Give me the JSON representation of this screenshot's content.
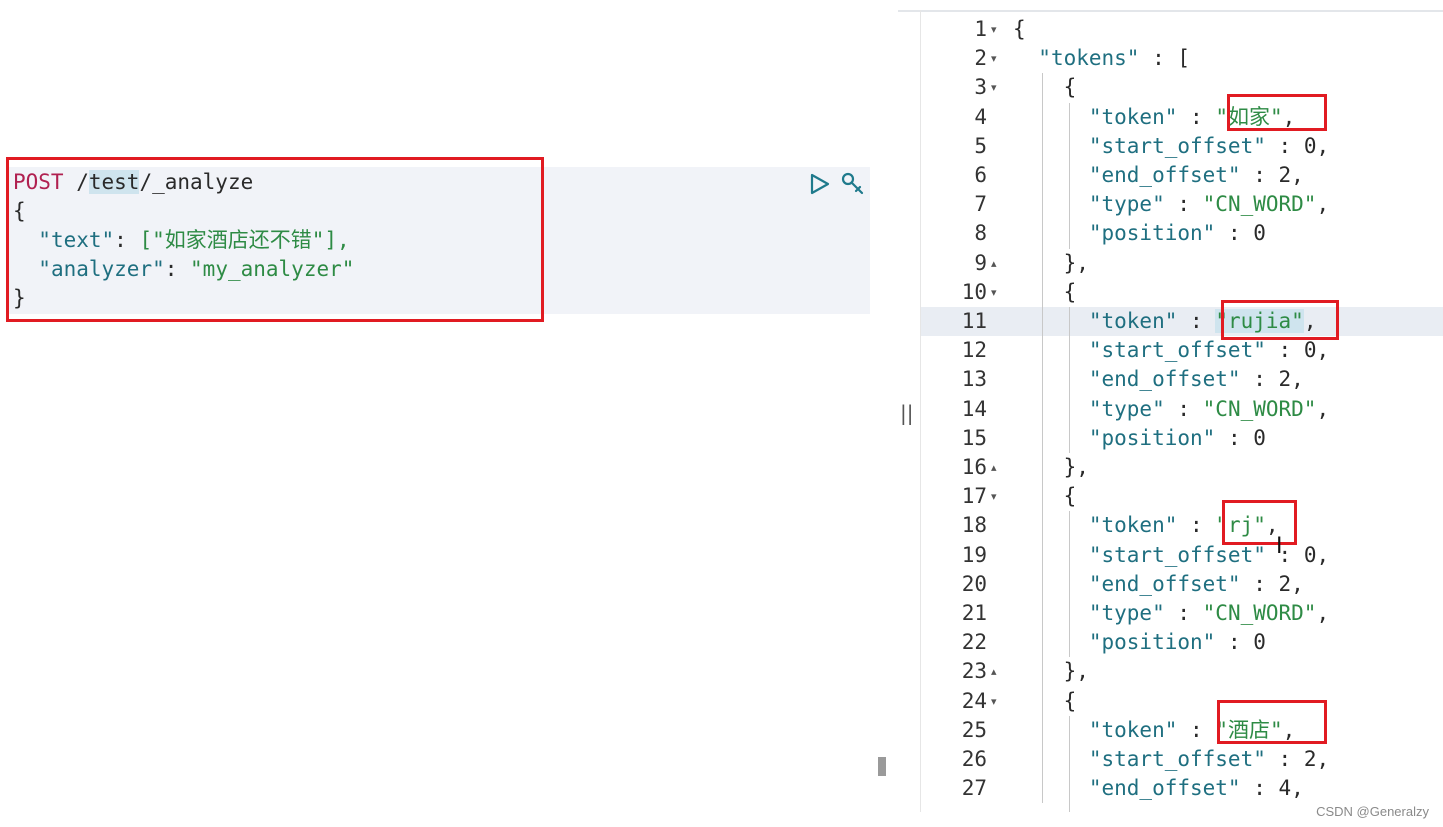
{
  "request": {
    "method": "POST",
    "path_prefix": " /",
    "index": "test",
    "path_suffix": "/_analyze",
    "open_brace": "{",
    "text_key": "\"text\"",
    "text_value": "[\"如家酒店还不错\"],",
    "analyzer_key": "\"analyzer\"",
    "analyzer_value": "\"my_analyzer\"",
    "close_brace": "}",
    "run_icon": "play-icon",
    "settings_icon": "wrench-icon"
  },
  "resize_handle": "||",
  "response": {
    "lines": [
      {
        "n": "1",
        "fold": "▾",
        "text": "{"
      },
      {
        "n": "2",
        "fold": "▾",
        "key": "\"tokens\"",
        "rest": " : ["
      },
      {
        "n": "3",
        "fold": "▾",
        "text": "{"
      },
      {
        "n": "4",
        "key": "\"token\"",
        "sep": " : ",
        "str": "\"如家\"",
        "rest": ","
      },
      {
        "n": "5",
        "key": "\"start_offset\"",
        "sep": " : ",
        "rest": "0,"
      },
      {
        "n": "6",
        "key": "\"end_offset\"",
        "sep": " : ",
        "rest": "2,"
      },
      {
        "n": "7",
        "key": "\"type\"",
        "sep": " : ",
        "str": "\"CN_WORD\"",
        "rest": ","
      },
      {
        "n": "8",
        "key": "\"position\"",
        "sep": " : ",
        "rest": "0"
      },
      {
        "n": "9",
        "fold": "▴",
        "text": "},"
      },
      {
        "n": "10",
        "fold": "▾",
        "text": "{"
      },
      {
        "n": "11",
        "key": "\"token\"",
        "sep": " : ",
        "str": "\"rujia\"",
        "rest": ","
      },
      {
        "n": "12",
        "key": "\"start_offset\"",
        "sep": " : ",
        "rest": "0,"
      },
      {
        "n": "13",
        "key": "\"end_offset\"",
        "sep": " : ",
        "rest": "2,"
      },
      {
        "n": "14",
        "key": "\"type\"",
        "sep": " : ",
        "str": "\"CN_WORD\"",
        "rest": ","
      },
      {
        "n": "15",
        "key": "\"position\"",
        "sep": " : ",
        "rest": "0"
      },
      {
        "n": "16",
        "fold": "▴",
        "text": "},"
      },
      {
        "n": "17",
        "fold": "▾",
        "text": "{"
      },
      {
        "n": "18",
        "key": "\"token\"",
        "sep": " : ",
        "str": "\"rj\"",
        "rest": ","
      },
      {
        "n": "19",
        "key": "\"start_offset\"",
        "sep": " : ",
        "rest": "0,"
      },
      {
        "n": "20",
        "key": "\"end_offset\"",
        "sep": " : ",
        "rest": "2,"
      },
      {
        "n": "21",
        "key": "\"type\"",
        "sep": " : ",
        "str": "\"CN_WORD\"",
        "rest": ","
      },
      {
        "n": "22",
        "key": "\"position\"",
        "sep": " : ",
        "rest": "0"
      },
      {
        "n": "23",
        "fold": "▴",
        "text": "},"
      },
      {
        "n": "24",
        "fold": "▾",
        "text": "{"
      },
      {
        "n": "25",
        "key": "\"token\"",
        "sep": " : ",
        "str": "\"酒店\"",
        "rest": ","
      },
      {
        "n": "26",
        "key": "\"start_offset\"",
        "sep": " : ",
        "rest": "2,"
      },
      {
        "n": "27",
        "key": "\"end_offset\"",
        "sep": " : ",
        "rest": "4,"
      }
    ]
  },
  "watermark": "CSDN @Generalzy",
  "cursor_glyph": "I"
}
